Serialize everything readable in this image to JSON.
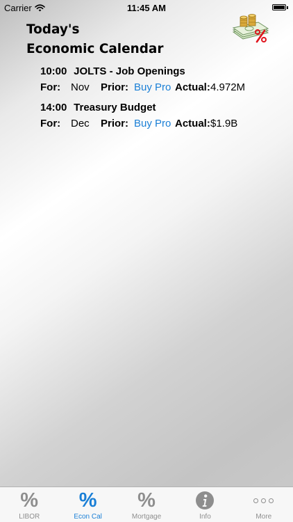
{
  "status_bar": {
    "carrier": "Carrier",
    "time": "11:45 AM"
  },
  "header": {
    "title_line1": "Today's",
    "title_line2": "Economic Calendar",
    "logo_icon": "money-percent-logo-icon"
  },
  "labels": {
    "for": "For:",
    "prior": "Prior:",
    "actual": "Actual:",
    "buy_pro": "Buy Pro"
  },
  "events": [
    {
      "time": "10:00",
      "name": "JOLTS - Job Openings",
      "for": "Nov",
      "prior": "Buy Pro",
      "actual": "4.972M"
    },
    {
      "time": "14:00",
      "name": "Treasury Budget",
      "for": "Dec",
      "prior": "Buy Pro",
      "actual": "$1.9B"
    }
  ],
  "tab_bar": {
    "tabs": [
      {
        "label": "LIBOR",
        "icon": "percent-icon",
        "active": false
      },
      {
        "label": "Econ Cal",
        "icon": "percent-icon",
        "active": true
      },
      {
        "label": "Mortgage",
        "icon": "percent-icon",
        "active": false
      },
      {
        "label": "Info",
        "icon": "info-icon",
        "active": false
      },
      {
        "label": "More",
        "icon": "more-dots-icon",
        "active": false
      }
    ]
  },
  "colors": {
    "accent": "#1a7fd6",
    "tab_inactive": "#8e8e8e",
    "logo_percent": "#e0141d"
  }
}
